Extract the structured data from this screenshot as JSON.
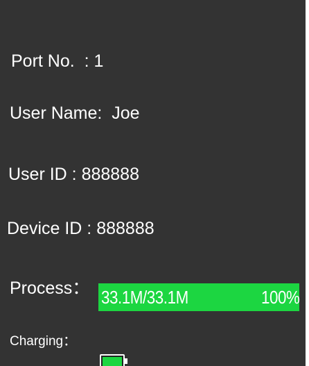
{
  "port": {
    "label": "Port No.  : 1"
  },
  "user_name": {
    "label": "User Name:  Joe"
  },
  "user_id": {
    "label": "User ID : 888888"
  },
  "device_id": {
    "label": "Device ID : 888888"
  },
  "process": {
    "label": "Process：",
    "size_text": "33.1M/33.1M",
    "percent_text": "100%",
    "progress_percent": 100
  },
  "charging": {
    "label": "Charging：",
    "battery_icon": "battery-icon",
    "battery_level_percent": 100
  },
  "colors": {
    "background": "#333333",
    "text": "#ffffff",
    "progress_green": "#1cd641"
  }
}
